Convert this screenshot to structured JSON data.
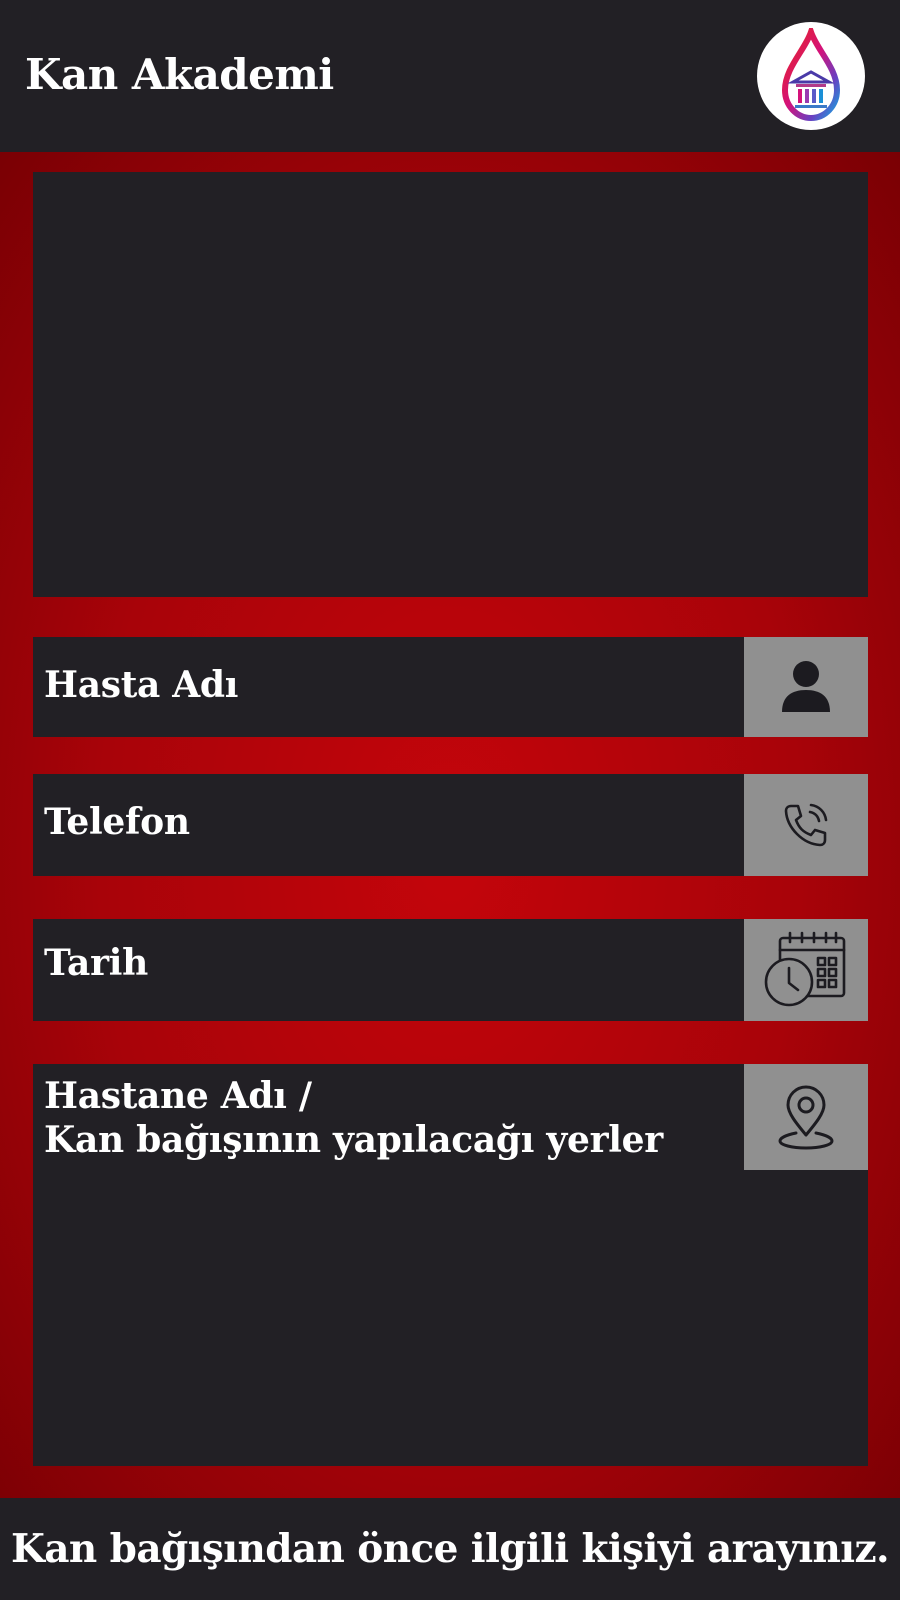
{
  "app": {
    "title": "Kan Akademi",
    "logo_icon": "blood-drop-academy-logo-icon"
  },
  "colors": {
    "background_dark": "#222025",
    "accent_red": "#c4050b",
    "icon_box_gray": "#909090",
    "text": "#ffffff"
  },
  "form": {
    "fields": [
      {
        "label": "Hasta Adı",
        "icon": "person-icon"
      },
      {
        "label": "Telefon",
        "icon": "phone-icon"
      },
      {
        "label": "Tarih",
        "icon": "calendar-clock-icon"
      },
      {
        "label_line1": "Hastane Adı /",
        "label_line2": "Kan bağışının yapılacağı yerler",
        "icon": "location-pin-icon"
      }
    ]
  },
  "footer": {
    "text": "Kan bağışından önce ilgili kişiyi arayınız."
  }
}
